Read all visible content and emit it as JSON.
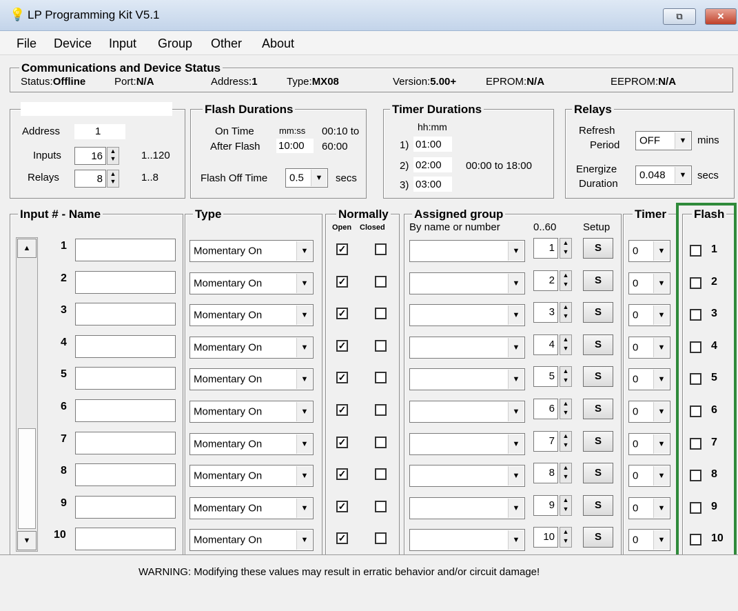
{
  "window": {
    "title": "LP Programming Kit V5.1",
    "icon": "bulb-icon"
  },
  "menu": [
    "File",
    "Device",
    "Input",
    "Group",
    "Other",
    "About"
  ],
  "status": {
    "legend": "Communications and Device Status",
    "status_label": "Status:",
    "status_value": "Offline",
    "port_label": "Port:",
    "port_value": "N/A",
    "address_label": "Address:",
    "address_value": "1",
    "type_label": "Type:",
    "type_value": "MX08",
    "version_label": "Version:",
    "version_value": "5.00+",
    "eprom_label": "EPROM:",
    "eprom_value": "N/A",
    "eeprom_label": "EEPROM:",
    "eeprom_value": "N/A"
  },
  "device": {
    "address_label": "Address",
    "address_value": "1",
    "inputs_label": "Inputs",
    "inputs_value": "16",
    "inputs_range": "1..120",
    "relays_label": "Relays",
    "relays_value": "8",
    "relays_range": "1..8"
  },
  "flash": {
    "legend": "Flash Durations",
    "on_time_label": "On Time",
    "mmss": "mm:ss",
    "on_range": "00:10 to",
    "after_flash_label": "After Flash",
    "after_flash_value": "10:00",
    "after_range": "60:00",
    "off_label": "Flash Off Time",
    "off_value": "0.5",
    "off_unit": "secs"
  },
  "timer_durations": {
    "legend": "Timer Durations",
    "hhmm": "hh:mm",
    "t1_label": "1)",
    "t1_value": "01:00",
    "t2_label": "2)",
    "t2_value": "02:00",
    "range": "00:00 to 18:00",
    "t3_label": "3)",
    "t3_value": "03:00"
  },
  "relays": {
    "legend": "Relays",
    "refresh_label_1": "Refresh",
    "refresh_label_2": "Period",
    "refresh_value": "OFF",
    "refresh_unit": "mins",
    "energize_label_1": "Energize",
    "energize_label_2": "Duration",
    "energize_value": "0.048",
    "energize_unit": "secs"
  },
  "columns": {
    "input_name": "Input # - Name",
    "type": "Type",
    "normally": "Normally",
    "open": "Open",
    "closed": "Closed",
    "assigned_group": "Assigned group",
    "by_name": "By name or number",
    "range": "0..60",
    "setup": "Setup",
    "timer": "Timer",
    "flash": "Flash"
  },
  "rows": [
    {
      "num": "1",
      "name": "",
      "type": "Momentary On",
      "open": true,
      "closed": false,
      "group_name": "",
      "group_num": "1",
      "setup": "S",
      "timer": "0",
      "flash": false
    },
    {
      "num": "2",
      "name": "",
      "type": "Momentary On",
      "open": true,
      "closed": false,
      "group_name": "",
      "group_num": "2",
      "setup": "S",
      "timer": "0",
      "flash": false
    },
    {
      "num": "3",
      "name": "",
      "type": "Momentary On",
      "open": true,
      "closed": false,
      "group_name": "",
      "group_num": "3",
      "setup": "S",
      "timer": "0",
      "flash": false
    },
    {
      "num": "4",
      "name": "",
      "type": "Momentary On",
      "open": true,
      "closed": false,
      "group_name": "",
      "group_num": "4",
      "setup": "S",
      "timer": "0",
      "flash": false
    },
    {
      "num": "5",
      "name": "",
      "type": "Momentary On",
      "open": true,
      "closed": false,
      "group_name": "",
      "group_num": "5",
      "setup": "S",
      "timer": "0",
      "flash": false
    },
    {
      "num": "6",
      "name": "",
      "type": "Momentary On",
      "open": true,
      "closed": false,
      "group_name": "",
      "group_num": "6",
      "setup": "S",
      "timer": "0",
      "flash": false
    },
    {
      "num": "7",
      "name": "",
      "type": "Momentary On",
      "open": true,
      "closed": false,
      "group_name": "",
      "group_num": "7",
      "setup": "S",
      "timer": "0",
      "flash": false
    },
    {
      "num": "8",
      "name": "",
      "type": "Momentary On",
      "open": true,
      "closed": false,
      "group_name": "",
      "group_num": "8",
      "setup": "S",
      "timer": "0",
      "flash": false
    },
    {
      "num": "9",
      "name": "",
      "type": "Momentary On",
      "open": true,
      "closed": false,
      "group_name": "",
      "group_num": "9",
      "setup": "S",
      "timer": "0",
      "flash": false
    },
    {
      "num": "10",
      "name": "",
      "type": "Momentary On",
      "open": true,
      "closed": false,
      "group_name": "",
      "group_num": "10",
      "setup": "S",
      "timer": "0",
      "flash": false
    }
  ],
  "footer": {
    "warning": "WARNING: Modifying these values may result in erratic behavior and/or circuit damage!"
  },
  "colors": {
    "highlight": "#2f8a3a"
  }
}
